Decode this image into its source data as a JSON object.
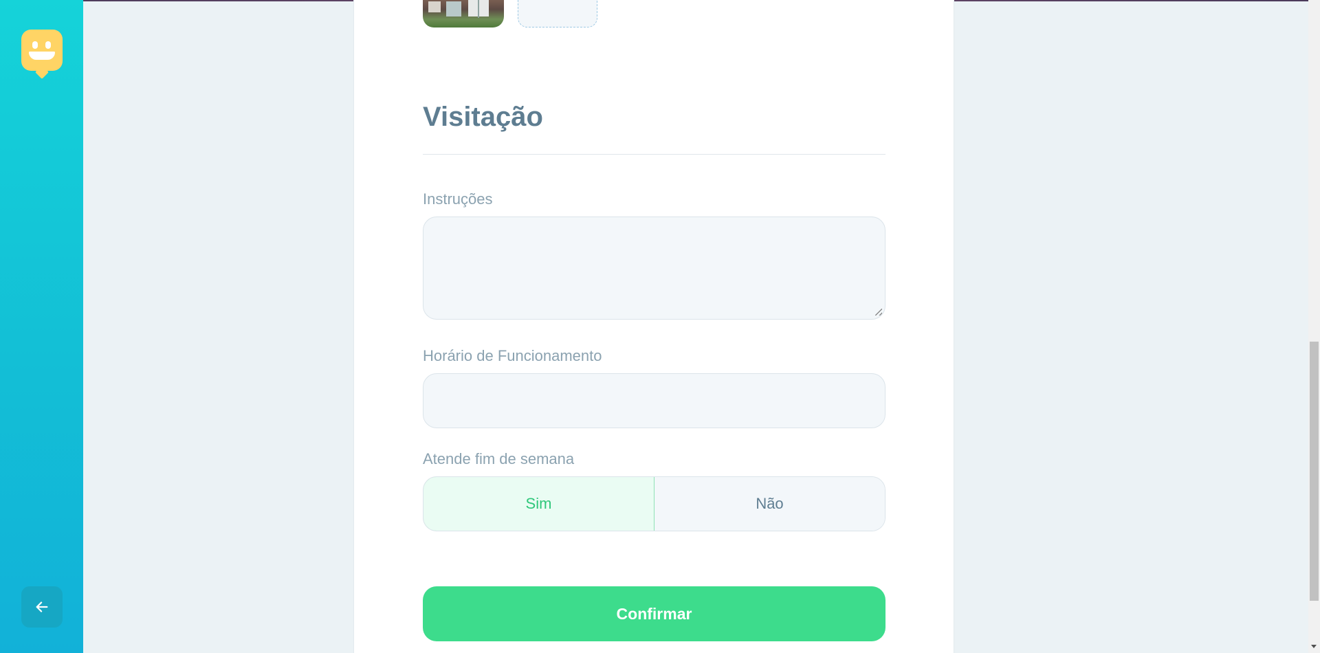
{
  "section": {
    "title": "Visitação"
  },
  "fields": {
    "instructions": {
      "label": "Instruções",
      "value": ""
    },
    "hours": {
      "label": "Horário de Funcionamento",
      "value": ""
    },
    "weekend": {
      "label": "Atende fim de semana",
      "options": [
        "Sim",
        "Não"
      ],
      "selected": "Sim"
    }
  },
  "actions": {
    "confirm_label": "Confirmar"
  },
  "sidebar": {
    "logo_icon": "smiley-chat-icon",
    "back_icon": "arrow-left-icon"
  },
  "colors": {
    "sidebar_top": "#15d3d9",
    "sidebar_bottom": "#12b1d8",
    "logo": "#ffd465",
    "title": "#5e7d91",
    "label": "#8ba2b0",
    "confirm": "#3ddc8c",
    "selected_text": "#2fc77a",
    "selected_bg": "#eafcf3"
  }
}
